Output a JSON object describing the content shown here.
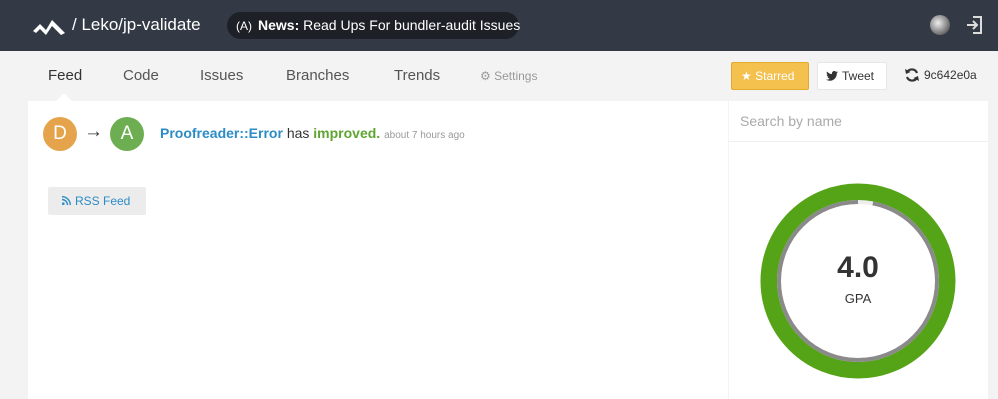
{
  "header": {
    "repo_path": "/ Leko/jp-validate",
    "news_prefix": "News:",
    "news_text": " Read Ups For bundler-audit Issues",
    "news_icon": "broadcast-icon",
    "account_icon": "avatar",
    "signout_icon": "sign-out-icon"
  },
  "nav": {
    "tabs": [
      {
        "label": "Feed",
        "active": true
      },
      {
        "label": "Code"
      },
      {
        "label": "Issues"
      },
      {
        "label": "Branches"
      },
      {
        "label": "Trends"
      }
    ],
    "settings_label": "Settings",
    "starred_label": "Starred",
    "tweet_label": "Tweet",
    "commit_sha": "9c642e0a"
  },
  "feed": {
    "from_grade": "D",
    "to_grade": "A",
    "arrow": "→",
    "class_name": "Proofreader::Error",
    "verb": "has",
    "change": "improved.",
    "time": "about 7 hours ago",
    "rss_label": "RSS Feed"
  },
  "sidebar": {
    "search_placeholder": "Search by name",
    "gpa_value": "4.0",
    "gpa_label": "GPA",
    "gpa_fraction": 0.97
  },
  "colors": {
    "topbar": "#333a45",
    "grade_a": "#6dae52",
    "grade_d": "#e5a44b",
    "link": "#2c8cc6",
    "improved": "#5ea631",
    "ring": "#55a316",
    "starred": "#f4c04e"
  }
}
